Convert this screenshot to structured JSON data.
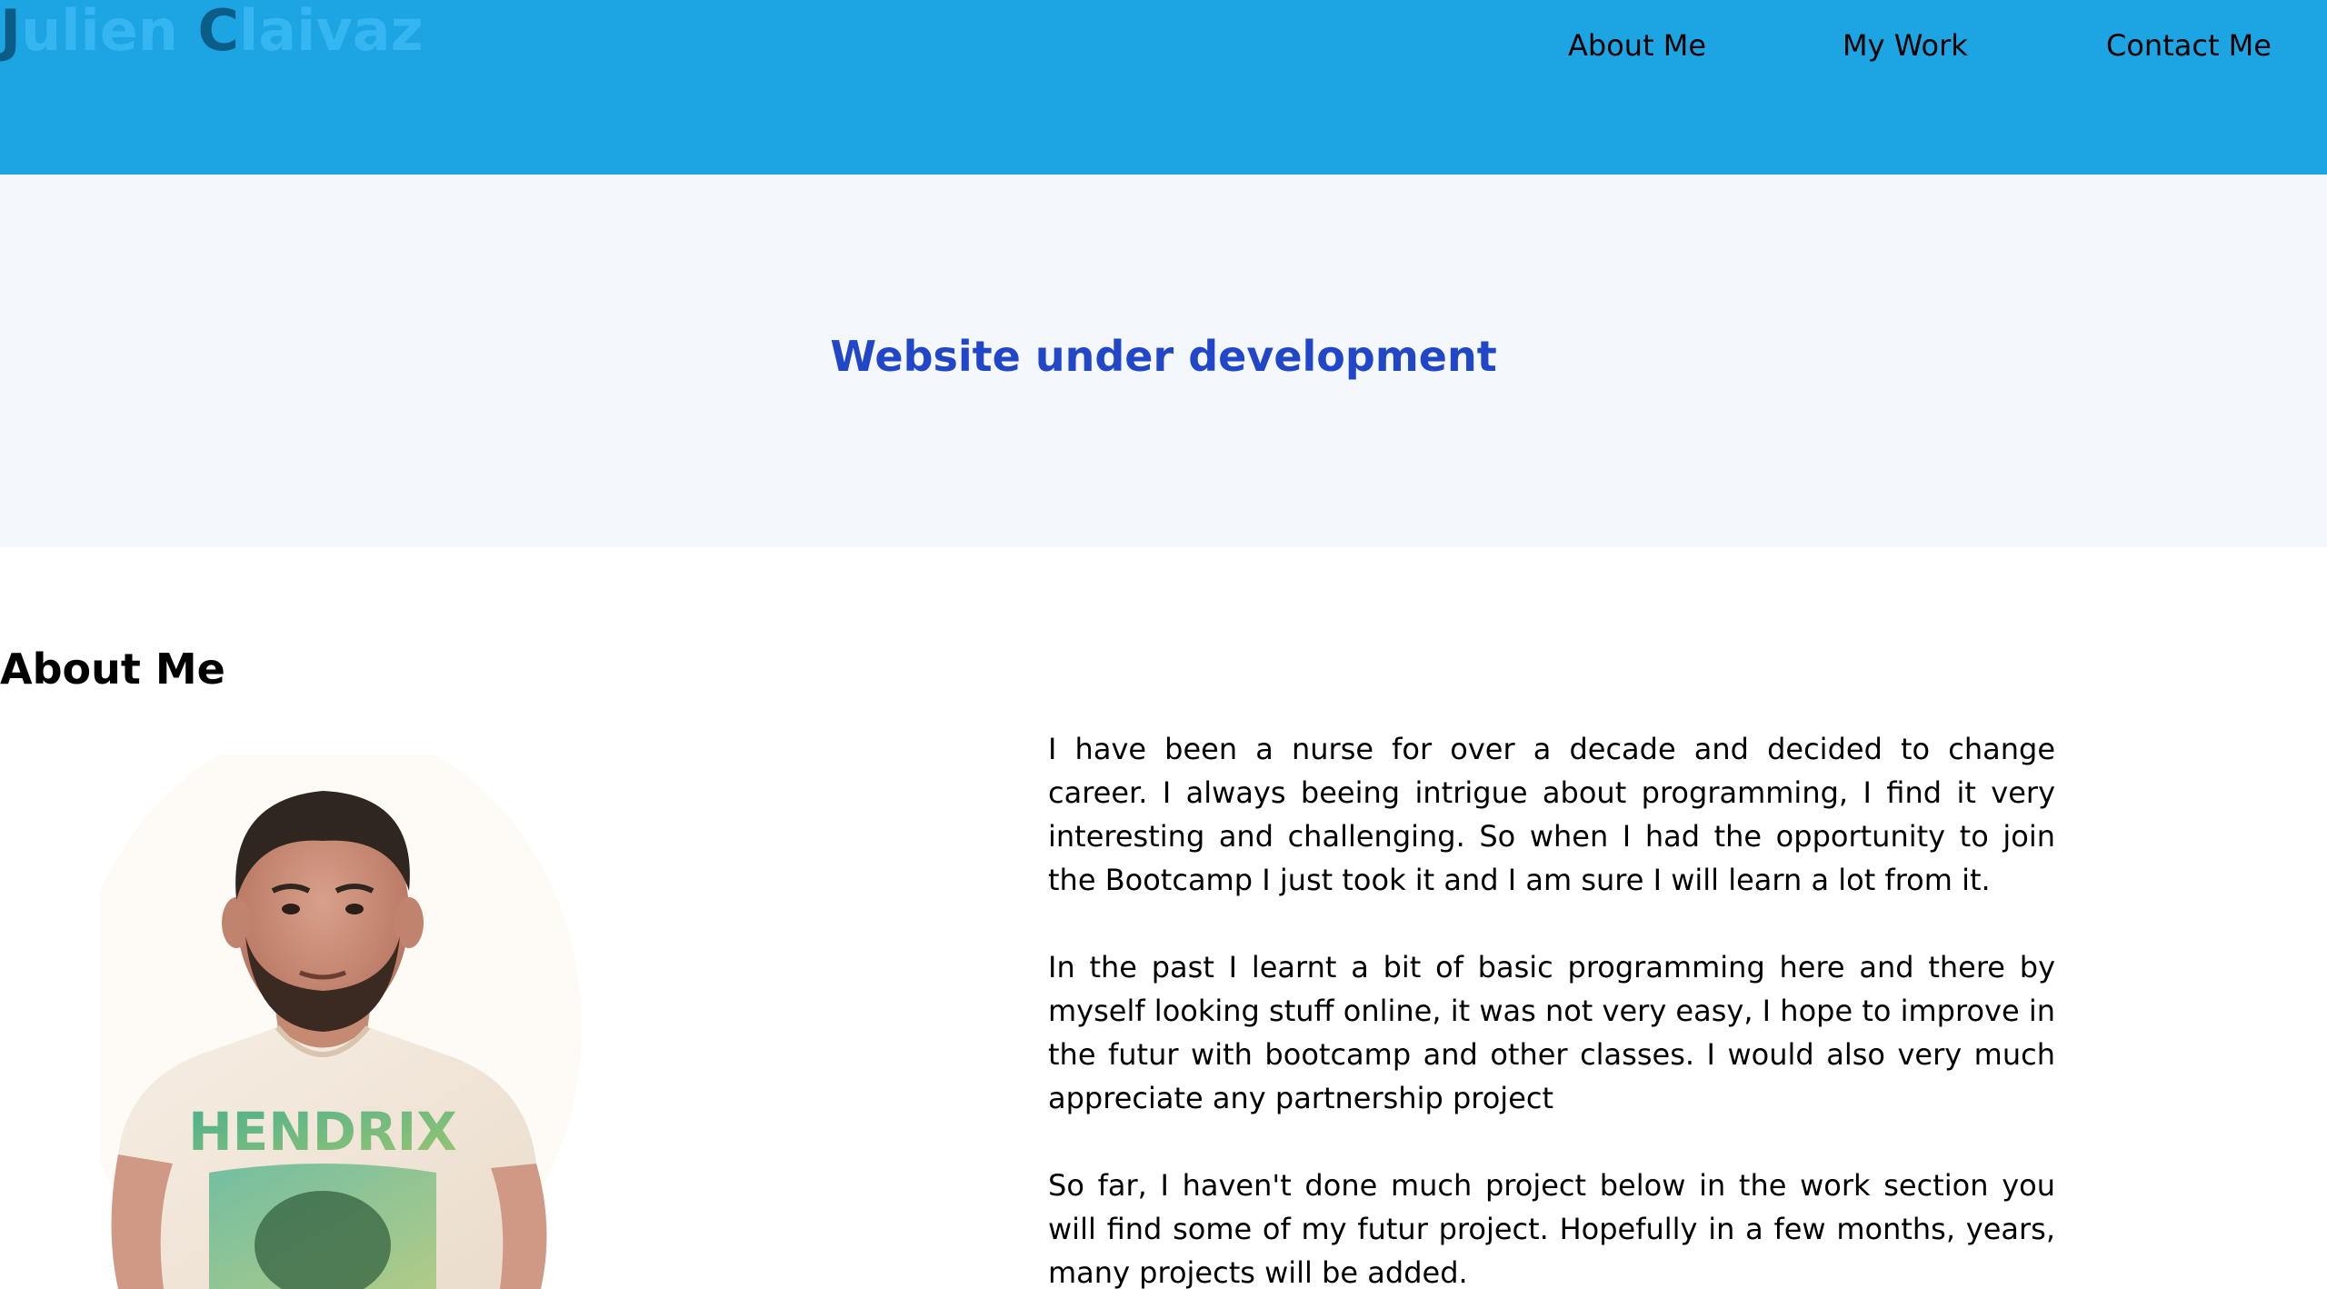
{
  "header": {
    "logo_first_initial": "J",
    "logo_first_rest": "ulien ",
    "logo_last_initial": "C",
    "logo_last_rest": "laivaz",
    "nav": {
      "about": "About Me",
      "work": "My Work",
      "contact": "Contact Me"
    }
  },
  "banner": {
    "title": "Website under development"
  },
  "about": {
    "heading": "About Me",
    "portrait_shirt_text": "HENDRIX",
    "paragraphs": [
      "I have been a nurse for over a decade and decided to change career. I always beeing intrigue about programming, I find it very interesting and challenging. So when I had the opportunity to join the Bootcamp I just took it and I am sure I will learn a lot from it.",
      "In the past I learnt a bit of basic programming here and there by myself looking stuff online, it was not very easy, I hope to improve in the futur with bootcamp and other classes. I would also very much appreciate any partnership project",
      "So far, I haven't done much project below in the work section you will find some of my futur project. Hopefully in a few months, years, many projects will be added."
    ]
  },
  "colors": {
    "header_bg": "#1ca4e3",
    "logo_initial": "#0b5c86",
    "logo_rest": "#35b6f0",
    "banner_bg": "#f4f8fc",
    "banner_title": "#2146c7"
  }
}
